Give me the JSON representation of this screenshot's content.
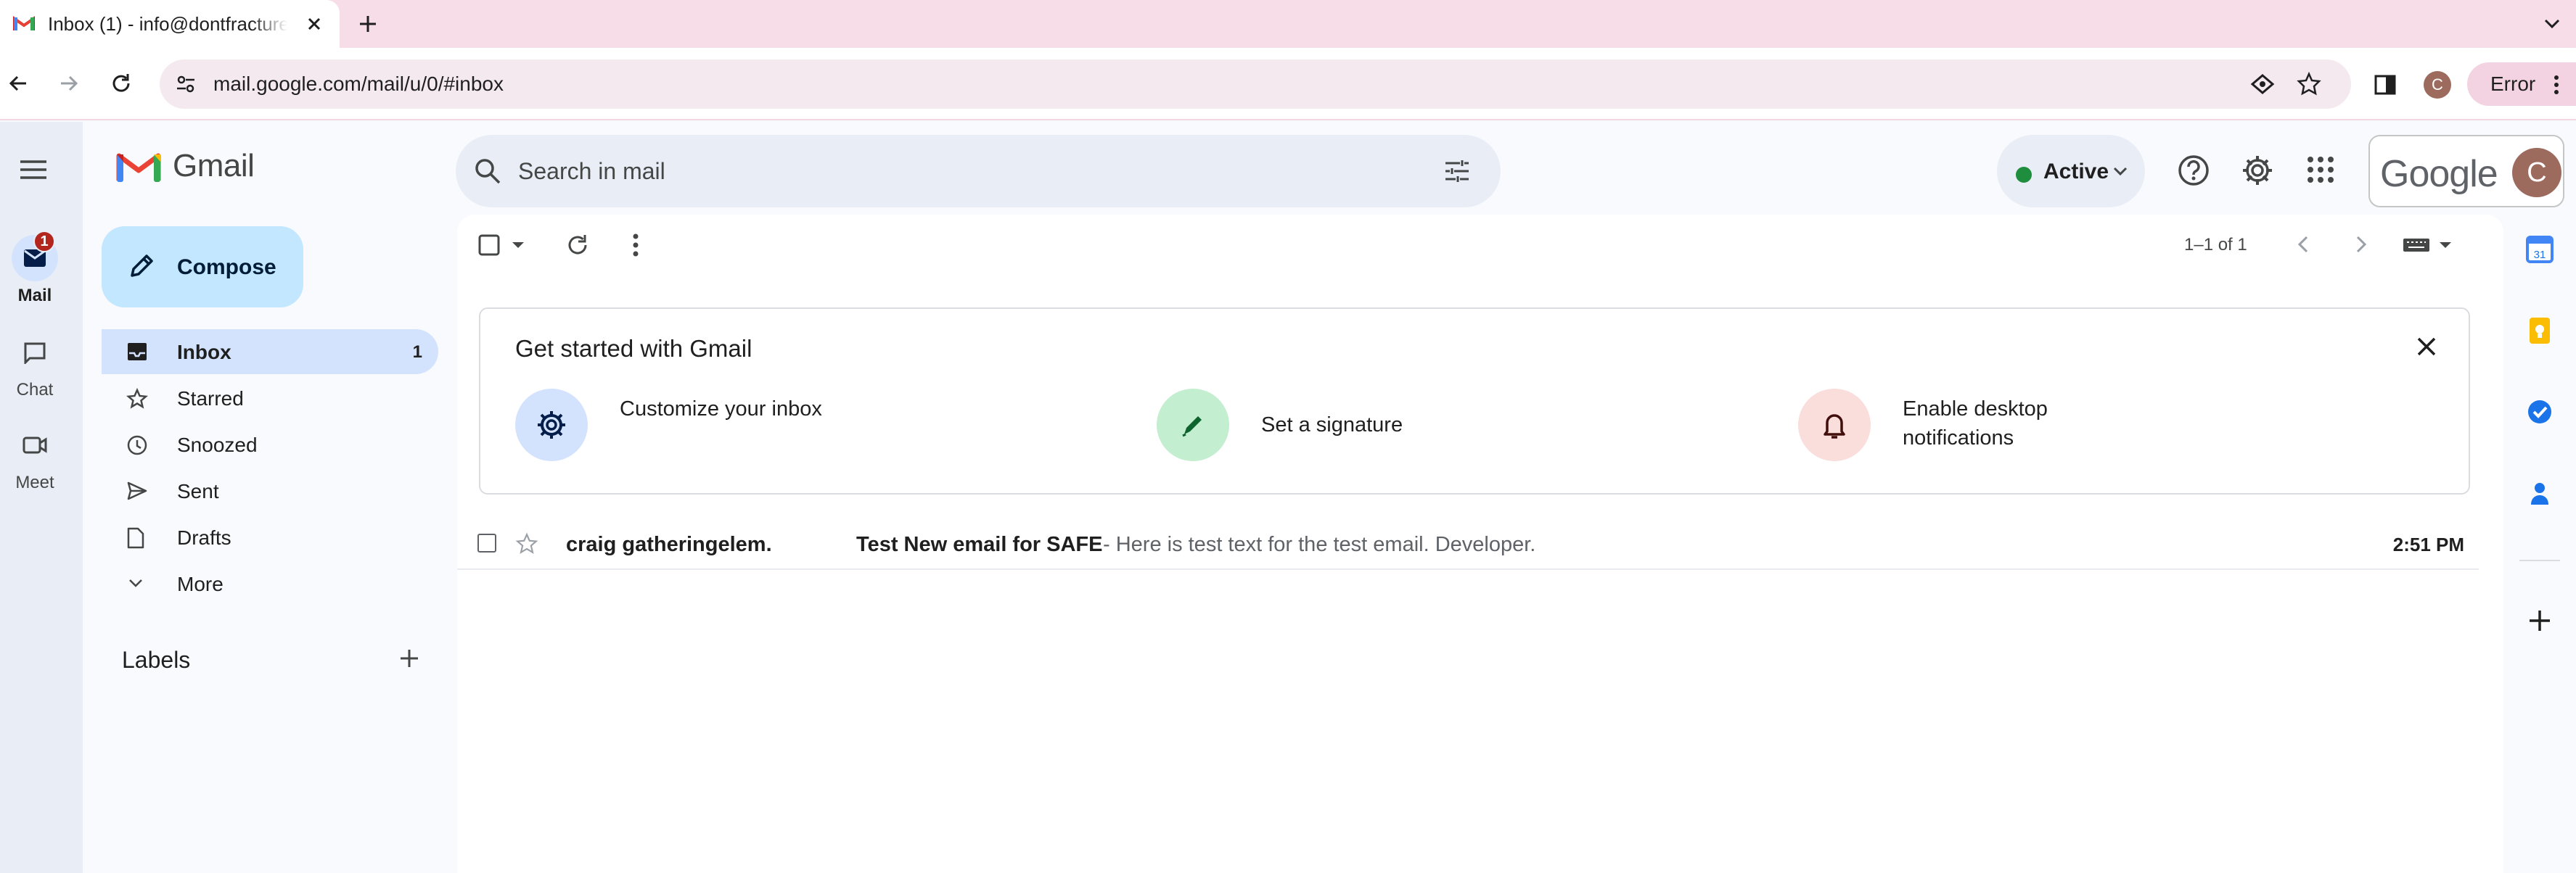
{
  "browser": {
    "tab_title": "Inbox (1) - info@dontfracture",
    "url": "mail.google.com/mail/u/0/#inbox",
    "profile_initial": "C",
    "error_label": "Error"
  },
  "gmail": {
    "app_name": "Gmail",
    "rail": [
      {
        "label": "Mail",
        "badge": "1"
      },
      {
        "label": "Chat"
      },
      {
        "label": "Meet"
      }
    ],
    "compose_label": "Compose",
    "nav": [
      {
        "label": "Inbox",
        "count": "1"
      },
      {
        "label": "Starred"
      },
      {
        "label": "Snoozed"
      },
      {
        "label": "Sent"
      },
      {
        "label": "Drafts"
      },
      {
        "label": "More"
      }
    ],
    "labels_heading": "Labels",
    "search_placeholder": "Search in mail",
    "status": "Active",
    "account": {
      "brand": "Google",
      "initial": "C"
    },
    "pager": "1–1 of 1",
    "welcome": {
      "title": "Get started with Gmail",
      "tips": [
        {
          "label": "Customize your inbox",
          "icon": "gear-icon",
          "color": "#d3e3fd"
        },
        {
          "label": "Set a signature",
          "icon": "pen-icon",
          "color": "#c4eed0"
        },
        {
          "label": "Enable desktop notifications",
          "icon": "bell-icon",
          "color": "#f9dedc"
        }
      ]
    },
    "messages": [
      {
        "from": "craig gatheringelem.",
        "subject": "Test New email for SAFE",
        "snippet": " - Here is test text for the test email. Developer.",
        "time": "2:51 PM"
      }
    ]
  },
  "colors": {
    "accent": "#0b57d0",
    "compose_bg": "#c2e7ff",
    "active_nav": "#d3e3fd",
    "tab_strip": "#f6dde8",
    "badge": "#b3261e"
  }
}
